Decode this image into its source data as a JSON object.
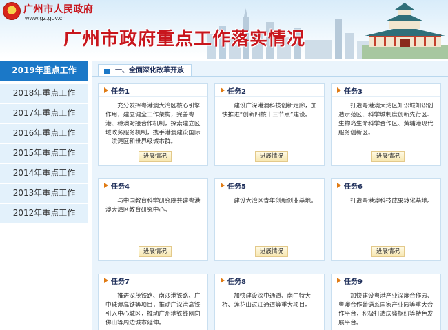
{
  "header": {
    "logo_text": "广州市人民政府",
    "logo_url": "www.gz.gov.cn",
    "title": "广州市政府重点工作落实情况"
  },
  "sidebar": {
    "items": [
      {
        "label": "2019年重点工作",
        "active": true
      },
      {
        "label": "2018年重点工作"
      },
      {
        "label": "2017年重点工作"
      },
      {
        "label": "2016年重点工作"
      },
      {
        "label": "2015年重点工作"
      },
      {
        "label": "2014年重点工作"
      },
      {
        "label": "2013年重点工作"
      },
      {
        "label": "2012年重点工作"
      }
    ]
  },
  "section": {
    "title": "一、全面深化改革开放"
  },
  "tasks": [
    {
      "label": "任务1",
      "text": "充分发挥粤港澳大湾区核心引擎作用，建立健全工作架构，完善粤港、穗澳对接合作机制，探索建立区域政务服务机制，携手港澳建设国际一流湾区和世界级城市群。",
      "button": "进展情况"
    },
    {
      "label": "任务2",
      "text": "建设广深港澳科技创新走廊，加快推进“创新四核十三节点”建设。",
      "button": "进展情况"
    },
    {
      "label": "任务3",
      "text": "打造粤港澳大湾区知识城知识创造示范区、科学城制度创新先行区、生物岛生命科学合作区、黄埔港现代服务创新区。",
      "button": "进展情况"
    },
    {
      "label": "任务4",
      "text": "与中国教育科学研究院共建粤港澳大湾区教育研究中心。",
      "button": "进展情况"
    },
    {
      "label": "任务5",
      "text": "建设大湾区青年创新创业基地。",
      "button": "进展情况"
    },
    {
      "label": "任务6",
      "text": "打造粤港澳科技成果转化基地。",
      "button": "进展情况"
    },
    {
      "label": "任务7",
      "text": "推进深茂铁路、南沙港铁路、广中珠澳高铁等项目，推动广深港高铁引入中心城区，推动广州地铁线网向佛山等周边城市延伸。",
      "button": ""
    },
    {
      "label": "任务8",
      "text": "加快建设深中通道、南中特大桥、莲花山过江通道等重大项目。",
      "button": ""
    },
    {
      "label": "任务9",
      "text": "加快建设粤港产业深度合作园、粤澳合作葡语系国家产业园等重大合作平台，积极打造庆盛枢纽等特色发展平台。",
      "button": ""
    }
  ],
  "colors": {
    "brand_red": "#c8161d",
    "accent_blue": "#1b78c7",
    "panel_bg": "#eaf4fc"
  }
}
